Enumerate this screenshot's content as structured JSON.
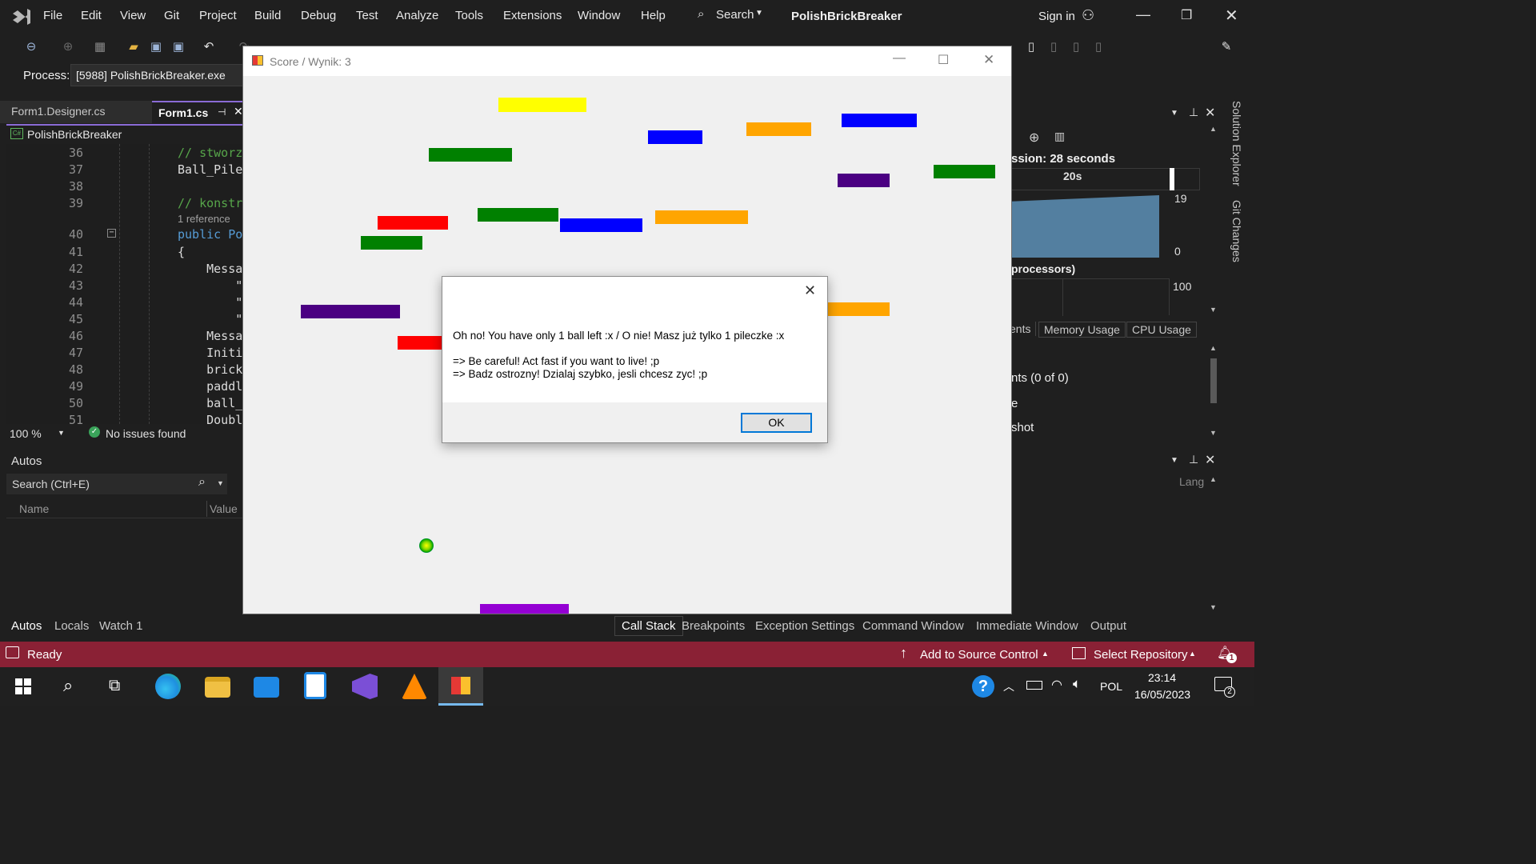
{
  "app": {
    "menu": [
      "File",
      "Edit",
      "View",
      "Git",
      "Project",
      "Build",
      "Debug",
      "Test",
      "Analyze",
      "Tools",
      "Extensions",
      "Window",
      "Help"
    ],
    "search_label": "Search",
    "solution_name": "PolishBrickBreaker",
    "sign_in": "Sign in"
  },
  "process_bar": {
    "label": "Process:",
    "value": "[5988] PolishBrickBreaker.exe"
  },
  "doc_tabs": [
    {
      "label": "Form1.Designer.cs",
      "active": false
    },
    {
      "label": "Form1.cs",
      "active": true
    }
  ],
  "editor": {
    "project_label": "PolishBrickBreaker",
    "lines": [
      {
        "num": "36",
        "text": "// stworz",
        "kind": "c"
      },
      {
        "num": "37",
        "text": "Ball_Pile",
        "kind": "t"
      },
      {
        "num": "38",
        "text": "",
        "kind": "t"
      },
      {
        "num": "39",
        "text": "// konstr",
        "kind": "c"
      },
      {
        "num": "",
        "text": "1 reference",
        "kind": "r"
      },
      {
        "num": "40",
        "text": "public Po",
        "kind": "k"
      },
      {
        "num": "41",
        "text": "{",
        "kind": "t"
      },
      {
        "num": "42",
        "text": "    Messa",
        "kind": "t"
      },
      {
        "num": "43",
        "text": "        \"",
        "kind": "t"
      },
      {
        "num": "44",
        "text": "        \"",
        "kind": "t"
      },
      {
        "num": "45",
        "text": "        \"",
        "kind": "t"
      },
      {
        "num": "46",
        "text": "    Messa",
        "kind": "t"
      },
      {
        "num": "47",
        "text": "    Initi",
        "kind": "t"
      },
      {
        "num": "48",
        "text": "    brick",
        "kind": "t"
      },
      {
        "num": "49",
        "text": "    paddl",
        "kind": "t"
      },
      {
        "num": "50",
        "text": "    ball_",
        "kind": "t"
      },
      {
        "num": "51",
        "text": "    Doubl",
        "kind": "t"
      }
    ],
    "zoom": "100 %",
    "issues": "No issues found"
  },
  "autos": {
    "title": "Autos",
    "search_placeholder": "Search (Ctrl+E)",
    "col_name": "Name",
    "col_value": "Value"
  },
  "bottom_tabs_left": [
    "Autos",
    "Locals",
    "Watch 1"
  ],
  "bottom_tabs_right": [
    "Call Stack",
    "Breakpoints",
    "Exception Settings",
    "Command Window",
    "Immediate Window",
    "Output"
  ],
  "diagnostics": {
    "session": "ssion: 28 seconds",
    "time_label": "20s",
    "mem_max": "19",
    "mem_min": "0",
    "cpu_label": "processors)",
    "cpu_max": "100",
    "tabs": [
      "ents",
      "Memory Usage",
      "CPU Usage"
    ],
    "events": "nts (0 of 0)",
    "row2": "e",
    "snapshot": "shot",
    "lang": "Lang"
  },
  "side_tabs": [
    "Solution Explorer",
    "Git Changes"
  ],
  "status": {
    "ready": "Ready",
    "source_control": "Add to Source Control",
    "repository": "Select Repository",
    "notifications": "1"
  },
  "taskbar": {
    "lang": "POL",
    "time": "23:14",
    "date": "16/05/2023",
    "notif_count": "2"
  },
  "game": {
    "title": "Score / Wynik: 3"
  },
  "dialog": {
    "line1": "Oh no! You have only 1 ball left :x / O nie! Masz już tylko 1 pileczke :x",
    "line2": "=> Be careful! Act fast if you want to live! ;p",
    "line3": "=> Badz ostrozny! Dzialaj szybko, jesli chcesz zyc! ;p",
    "ok": "OK"
  },
  "colors": {
    "yellow": "#ffff00",
    "green": "#008000",
    "blue": "#0000ff",
    "orange": "#ffa500",
    "purple": "#4b0082",
    "red": "#ff0000",
    "paddle": "#9400d3",
    "status_bar": "#8a2135"
  }
}
